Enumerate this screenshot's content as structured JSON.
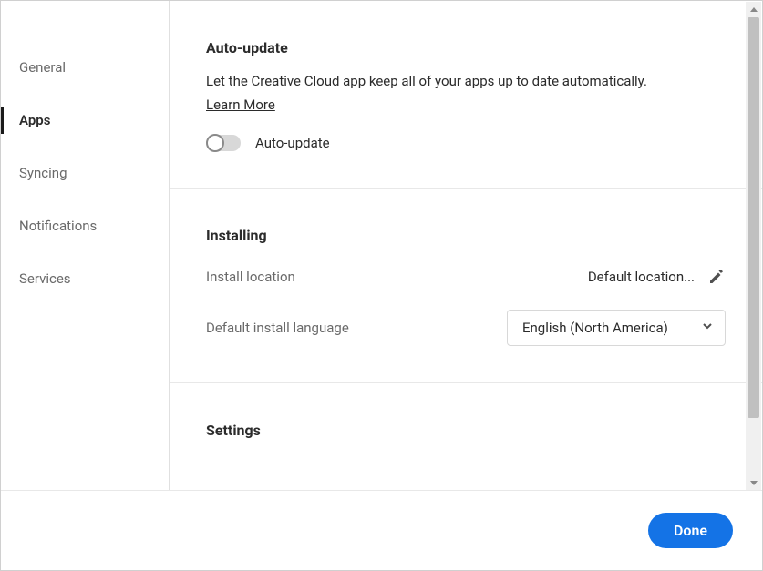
{
  "sidebar": {
    "items": [
      {
        "label": "General",
        "active": false
      },
      {
        "label": "Apps",
        "active": true
      },
      {
        "label": "Syncing",
        "active": false
      },
      {
        "label": "Notifications",
        "active": false
      },
      {
        "label": "Services",
        "active": false
      }
    ]
  },
  "autoUpdate": {
    "title": "Auto-update",
    "description": "Let the Creative Cloud app keep all of your apps up to date automatically.",
    "learnMore": "Learn More",
    "toggleLabel": "Auto-update",
    "toggleOn": false
  },
  "installing": {
    "title": "Installing",
    "locationLabel": "Install location",
    "locationValue": "Default location...",
    "languageLabel": "Default install language",
    "languageValue": "English (North America)"
  },
  "settings": {
    "title": "Settings"
  },
  "footer": {
    "done": "Done"
  }
}
